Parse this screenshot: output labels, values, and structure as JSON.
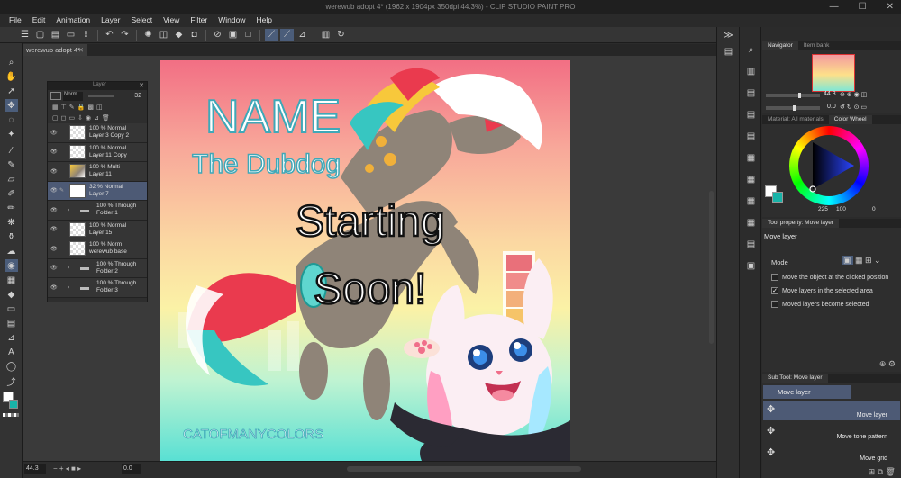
{
  "window": {
    "title": "werewub adopt 4* (1962 x 1904px 350dpi 44.3%) - CLIP STUDIO PAINT PRO",
    "minimize": "—",
    "maximize": "☐",
    "close": "✕"
  },
  "menu": [
    "File",
    "Edit",
    "Animation",
    "Layer",
    "Select",
    "View",
    "Filter",
    "Window",
    "Help"
  ],
  "doc_tab": {
    "label": "werewub adopt 4*",
    "close": "✕"
  },
  "status": {
    "zoom": "44.3",
    "rotation": "0.0"
  },
  "layer_panel": {
    "title": "Layer",
    "blend_mode": "Norm",
    "opacity": "32",
    "layers": [
      {
        "line1": "100 % Normal",
        "line2": "Layer 3 Copy 2",
        "kind": "check",
        "selected": false
      },
      {
        "line1": "100 % Normal",
        "line2": "Layer 11 Copy",
        "kind": "check",
        "selected": false
      },
      {
        "line1": "100 % Multi",
        "line2": "Layer 11",
        "kind": "art",
        "selected": false
      },
      {
        "line1": "32 % Normal",
        "line2": "Layer 7",
        "kind": "white",
        "selected": true
      },
      {
        "line1": "100 % Through",
        "line2": "Folder 1",
        "kind": "folder",
        "selected": false
      },
      {
        "line1": "100 % Normal",
        "line2": "Layer 15",
        "kind": "check",
        "selected": false
      },
      {
        "line1": "100 % Norm",
        "line2": "werewub base",
        "kind": "check",
        "selected": false
      },
      {
        "line1": "100 % Through",
        "line2": "Folder 2",
        "kind": "folder",
        "selected": false
      },
      {
        "line1": "100 % Through",
        "line2": "Folder 3",
        "kind": "folder",
        "selected": false
      }
    ]
  },
  "artwork": {
    "name_text": "NAME",
    "subtitle_text": "The Dubdog",
    "starting_text": "Starting",
    "soon_text": "Soon!",
    "logo_text": "CATOFMANYCOLORS",
    "swatches": [
      "#e9707a",
      "#f08c8a",
      "#f3b07a",
      "#f6c468",
      "#f7dc71",
      "#97dbb7",
      "#39b7b1"
    ]
  },
  "navigator": {
    "tab_navigator": "Navigator",
    "tab_item_bank": "Item bank",
    "zoom": "44.3",
    "rotation": "0.0"
  },
  "color_panel": {
    "tab_material": "Material: All materials",
    "tab_color_wheel": "Color Wheel",
    "h": "225",
    "s": "100",
    "v": "0",
    "main_color": "#ffffff",
    "sub_color": "#18b3a8"
  },
  "tool_property": {
    "tab": "Tool property: Move layer",
    "title": "Move layer",
    "mode_label": "Mode",
    "options": [
      {
        "label": "Move the object at the clicked position",
        "checked": false
      },
      {
        "label": "Move layers in the selected area",
        "checked": true
      },
      {
        "label": "Moved layers become selected",
        "checked": false
      }
    ]
  },
  "sub_tool": {
    "tab": "Sub Tool: Move layer",
    "header": "Move layer",
    "items": [
      "Move layer",
      "Move tone pattern",
      "Move grid"
    ]
  }
}
